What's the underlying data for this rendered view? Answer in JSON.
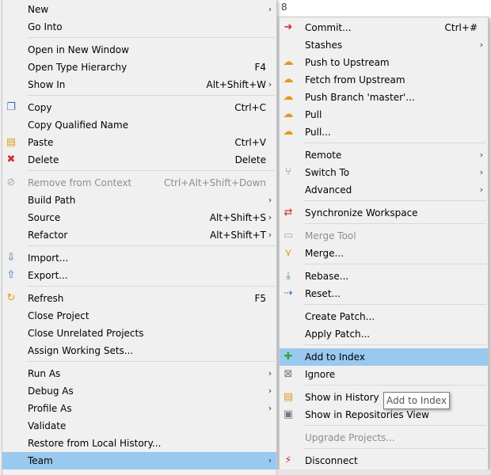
{
  "editor": {
    "fragment": "8"
  },
  "main_menu": {
    "items": [
      {
        "label": "New",
        "shortcut": "",
        "submenu": true,
        "icon": ""
      },
      {
        "label": "Go Into",
        "shortcut": "",
        "submenu": false,
        "icon": ""
      },
      {
        "label": "Open in New Window",
        "shortcut": "",
        "submenu": false,
        "icon": ""
      },
      {
        "label": "Open Type Hierarchy",
        "shortcut": "F4",
        "submenu": false,
        "icon": ""
      },
      {
        "label": "Show In",
        "shortcut": "Alt+Shift+W",
        "submenu": true,
        "icon": ""
      },
      {
        "label": "Copy",
        "shortcut": "Ctrl+C",
        "submenu": false,
        "icon": "copy-icon"
      },
      {
        "label": "Copy Qualified Name",
        "shortcut": "",
        "submenu": false,
        "icon": ""
      },
      {
        "label": "Paste",
        "shortcut": "Ctrl+V",
        "submenu": false,
        "icon": "paste-icon"
      },
      {
        "label": "Delete",
        "shortcut": "Delete",
        "submenu": false,
        "icon": "delete-icon"
      },
      {
        "label": "Remove from Context",
        "shortcut": "Ctrl+Alt+Shift+Down",
        "submenu": false,
        "icon": "remove-context-icon",
        "disabled": true
      },
      {
        "label": "Build Path",
        "shortcut": "",
        "submenu": true,
        "icon": ""
      },
      {
        "label": "Source",
        "shortcut": "Alt+Shift+S",
        "submenu": true,
        "icon": ""
      },
      {
        "label": "Refactor",
        "shortcut": "Alt+Shift+T",
        "submenu": true,
        "icon": ""
      },
      {
        "label": "Import...",
        "shortcut": "",
        "submenu": false,
        "icon": "import-icon"
      },
      {
        "label": "Export...",
        "shortcut": "",
        "submenu": false,
        "icon": "export-icon"
      },
      {
        "label": "Refresh",
        "shortcut": "F5",
        "submenu": false,
        "icon": "refresh-icon"
      },
      {
        "label": "Close Project",
        "shortcut": "",
        "submenu": false,
        "icon": ""
      },
      {
        "label": "Close Unrelated Projects",
        "shortcut": "",
        "submenu": false,
        "icon": ""
      },
      {
        "label": "Assign Working Sets...",
        "shortcut": "",
        "submenu": false,
        "icon": ""
      },
      {
        "label": "Run As",
        "shortcut": "",
        "submenu": true,
        "icon": ""
      },
      {
        "label": "Debug As",
        "shortcut": "",
        "submenu": true,
        "icon": ""
      },
      {
        "label": "Profile As",
        "shortcut": "",
        "submenu": true,
        "icon": ""
      },
      {
        "label": "Validate",
        "shortcut": "",
        "submenu": false,
        "icon": ""
      },
      {
        "label": "Restore from Local History...",
        "shortcut": "",
        "submenu": false,
        "icon": ""
      },
      {
        "label": "Team",
        "shortcut": "",
        "submenu": true,
        "icon": "",
        "highlighted": true
      }
    ]
  },
  "team_menu": {
    "items": [
      {
        "label": "Commit...",
        "shortcut": "Ctrl+#",
        "submenu": false,
        "icon": "commit-icon"
      },
      {
        "label": "Stashes",
        "shortcut": "",
        "submenu": true,
        "icon": ""
      },
      {
        "label": "Push to Upstream",
        "shortcut": "",
        "submenu": false,
        "icon": "push-upstream-icon"
      },
      {
        "label": "Fetch from Upstream",
        "shortcut": "",
        "submenu": false,
        "icon": "fetch-upstream-icon"
      },
      {
        "label": "Push Branch 'master'...",
        "shortcut": "",
        "submenu": false,
        "icon": "push-branch-icon"
      },
      {
        "label": "Pull",
        "shortcut": "",
        "submenu": false,
        "icon": "pull-icon"
      },
      {
        "label": "Pull...",
        "shortcut": "",
        "submenu": false,
        "icon": "pull-dialog-icon"
      },
      {
        "label": "Remote",
        "shortcut": "",
        "submenu": true,
        "icon": ""
      },
      {
        "label": "Switch To",
        "shortcut": "",
        "submenu": true,
        "icon": "switch-to-icon"
      },
      {
        "label": "Advanced",
        "shortcut": "",
        "submenu": true,
        "icon": ""
      },
      {
        "label": "Synchronize Workspace",
        "shortcut": "",
        "submenu": false,
        "icon": "synchronize-icon"
      },
      {
        "label": "Merge Tool",
        "shortcut": "",
        "submenu": false,
        "icon": "merge-tool-icon",
        "disabled": true
      },
      {
        "label": "Merge...",
        "shortcut": "",
        "submenu": false,
        "icon": "merge-icon"
      },
      {
        "label": "Rebase...",
        "shortcut": "",
        "submenu": false,
        "icon": "rebase-icon"
      },
      {
        "label": "Reset...",
        "shortcut": "",
        "submenu": false,
        "icon": "reset-icon"
      },
      {
        "label": "Create Patch...",
        "shortcut": "",
        "submenu": false,
        "icon": ""
      },
      {
        "label": "Apply Patch...",
        "shortcut": "",
        "submenu": false,
        "icon": ""
      },
      {
        "label": "Add to Index",
        "shortcut": "",
        "submenu": false,
        "icon": "add-to-index-icon",
        "highlighted": true
      },
      {
        "label": "Ignore",
        "shortcut": "",
        "submenu": false,
        "icon": "ignore-icon"
      },
      {
        "label": "Show in History",
        "shortcut": "",
        "submenu": false,
        "icon": "show-history-icon"
      },
      {
        "label": "Show in Repositories View",
        "shortcut": "",
        "submenu": false,
        "icon": "repositories-view-icon"
      },
      {
        "label": "Upgrade Projects...",
        "shortcut": "",
        "submenu": false,
        "icon": "",
        "disabled": true
      },
      {
        "label": "Disconnect",
        "shortcut": "",
        "submenu": false,
        "icon": "disconnect-icon"
      }
    ]
  },
  "tooltip": {
    "text": "Add to Index"
  }
}
